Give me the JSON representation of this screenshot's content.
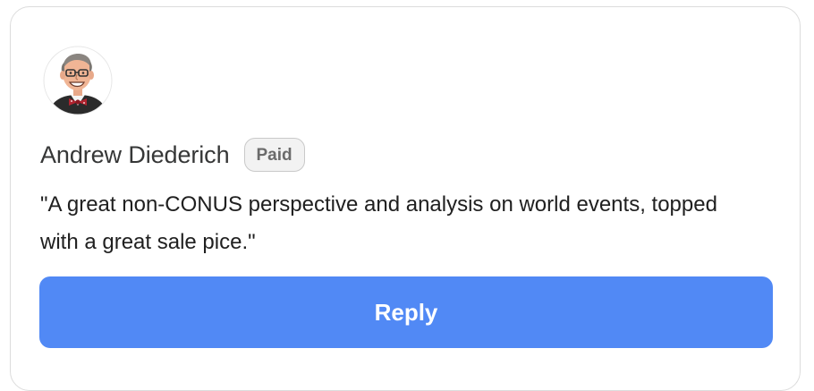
{
  "comment": {
    "author_name": "Andrew Diederich",
    "badge_label": "Paid",
    "text": "\"A great non-CONUS perspective and analysis on world events, topped with a great sale pice.\"",
    "avatar_icon": "caricature-avatar-icon"
  },
  "actions": {
    "reply_label": "Reply"
  },
  "colors": {
    "reply_button": "#5189f5",
    "badge_background": "#f2f2f2",
    "card_border": "#dcdcdc"
  }
}
